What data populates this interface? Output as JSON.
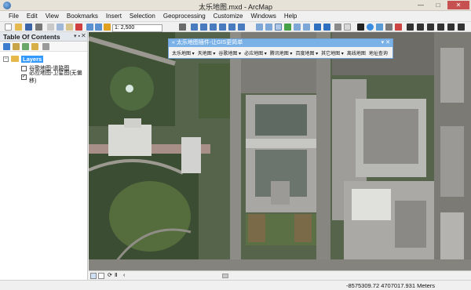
{
  "window": {
    "title": "太乐地图.mxd - ArcMap",
    "minimize_glyph": "—",
    "maximize_glyph": "□",
    "close_glyph": "✕"
  },
  "menu": [
    "File",
    "Edit",
    "View",
    "Bookmarks",
    "Insert",
    "Selection",
    "Geoprocessing",
    "Customize",
    "Windows",
    "Help"
  ],
  "toolbar": {
    "scale": "1: 2,500"
  },
  "toc": {
    "title": "Table Of Contents",
    "pin_glyph": "▾ ▪",
    "close_glyph": "✕",
    "collapse_glyph": "−",
    "root_label": "Layers",
    "layers": [
      {
        "label": "谷歌地图-道路图",
        "checked": false
      },
      {
        "label": "必应地图-卫星图(无偏移)",
        "checked": true
      }
    ]
  },
  "plugin": {
    "title": "« 太乐地图插件-让GIS更简单",
    "controls": "▾ ✕",
    "menus": [
      "太乐地图 ▾",
      "天地图 ▾",
      "谷歌地图 ▾",
      "必应地图 ▾",
      "腾讯地图 ▾",
      "百度地图 ▾",
      "其它地图 ▾",
      "离线地图",
      "地址查询"
    ]
  },
  "status": {
    "coordinates": "-8575309.72  4707017.931 Meters"
  },
  "colors": {
    "toolbar_bg": "#f0f0f0",
    "selection": "#3399ff",
    "plugin_title": "#7ab2e8",
    "close_red": "#c75050"
  }
}
